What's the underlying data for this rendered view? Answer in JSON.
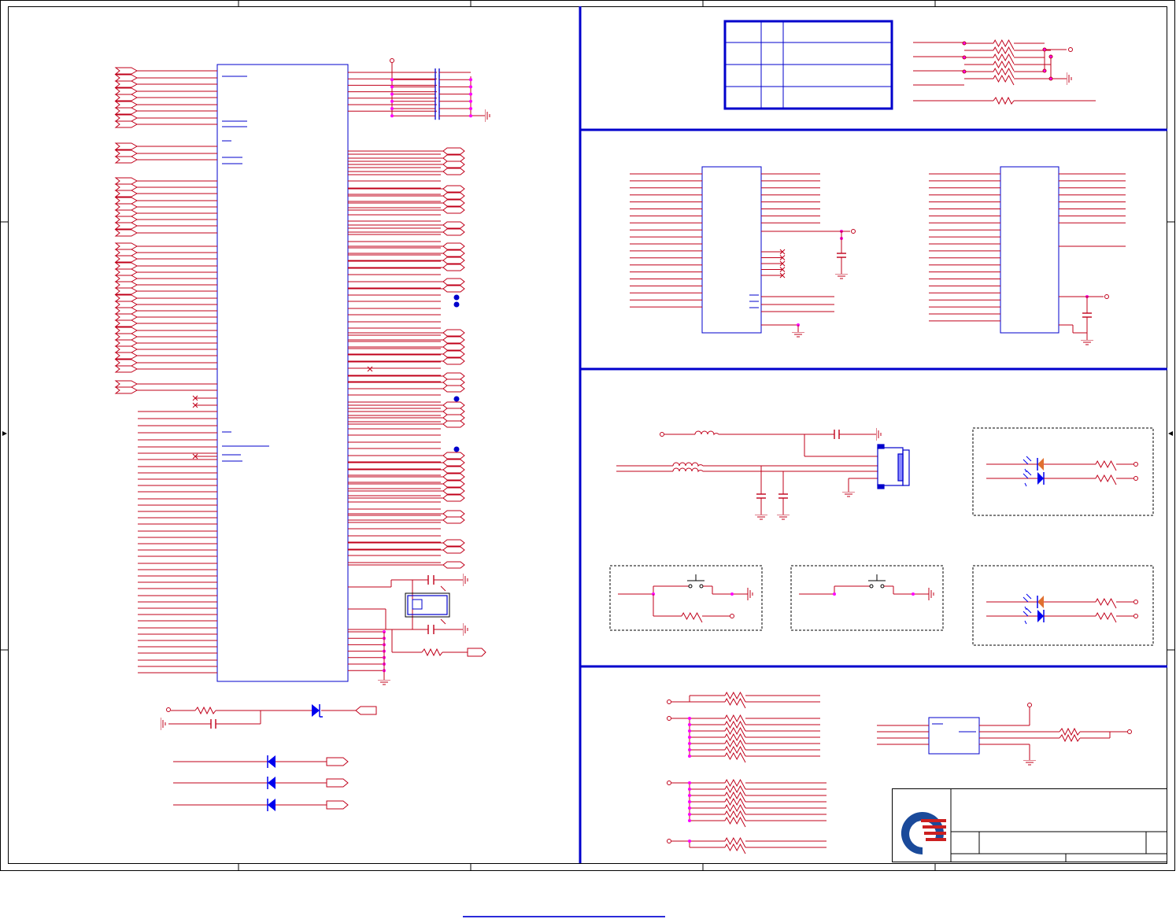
{
  "document": {
    "kind": "schematic-sheet",
    "border_zone_marks": 4,
    "text_content": []
  },
  "colors": {
    "wire": "#c0001a",
    "border": "#0000cc",
    "frame": "#000000",
    "junction": "#ff00ff",
    "dot": "#0000cc",
    "led_amber": "#e07030",
    "led_blue": "#0000ee",
    "logo_blue": "#1a4a9a",
    "logo_red": "#cc2020"
  },
  "icons": {
    "crystal": "crystal-icon",
    "diode": "diode-icon",
    "led": "led-icon",
    "ground": "ground-icon",
    "resistor": "resistor-icon",
    "capacitor": "capacitor-icon",
    "inductor": "inductor-icon",
    "switch": "switch-icon",
    "connector": "connector-icon",
    "logo": "company-logo-icon"
  }
}
